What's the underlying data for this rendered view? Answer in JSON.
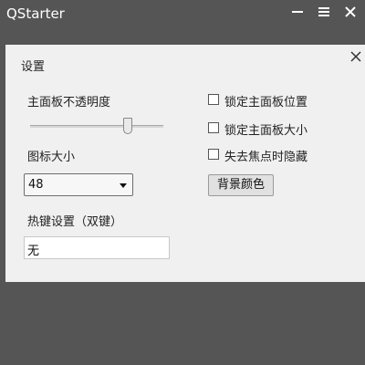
{
  "window": {
    "title": "QStarter",
    "controls": {
      "minimize": "minimize-icon",
      "menu": "menu-icon",
      "close": "close-icon"
    }
  },
  "dialog": {
    "title": "设置",
    "close_icon": "close-icon",
    "opacity": {
      "label": "主面板不透明度",
      "slider_fraction": 0.75
    },
    "icon_size": {
      "label": "图标大小",
      "selected": "48"
    },
    "hotkey": {
      "label": "热键设置（双键）",
      "value": "无"
    },
    "checkboxes": [
      {
        "label": "锁定主面板位置",
        "checked": false
      },
      {
        "label": "锁定主面板大小",
        "checked": false
      },
      {
        "label": "失去焦点时隐藏",
        "checked": false
      }
    ],
    "bg_color_button": "背景颜色"
  },
  "colors": {
    "window_bg": "#555555",
    "dialog_bg": "#f0f0f0",
    "title_text": "#ffffff"
  }
}
